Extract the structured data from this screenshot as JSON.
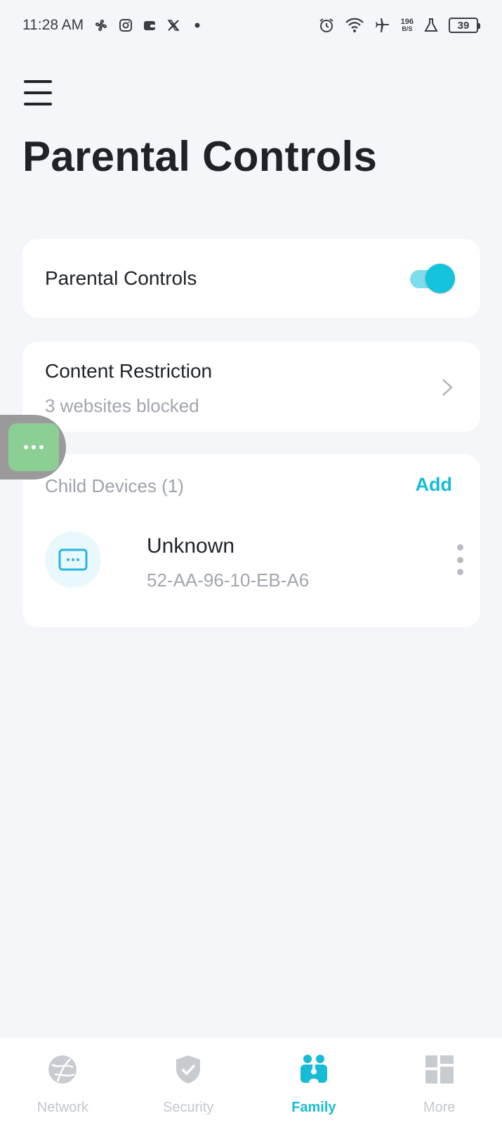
{
  "status_bar": {
    "time": "11:28 AM",
    "left_icons": [
      "fan-icon",
      "instagram-icon",
      "wallet-icon",
      "x-icon",
      "dot-icon"
    ],
    "right_icons": [
      "alarm-icon",
      "wifi-icon",
      "airplane-icon",
      "flask-icon"
    ],
    "net_speed_value": "196",
    "net_speed_unit": "B/S",
    "battery": "39"
  },
  "header": {
    "menu_icon": "hamburger-menu-icon",
    "title": "Parental Controls"
  },
  "parental_controls": {
    "label": "Parental Controls",
    "enabled": true
  },
  "content_restriction": {
    "title": "Content Restriction",
    "subtitle": "3 websites blocked"
  },
  "child_devices": {
    "header": "Child Devices (1)",
    "add_label": "Add",
    "devices": [
      {
        "name": "Unknown",
        "mac": "52-AA-96-10-EB-A6",
        "icon": "device-icon"
      }
    ]
  },
  "bottom_nav": {
    "items": [
      {
        "label": "Network",
        "icon": "globe-icon",
        "active": false
      },
      {
        "label": "Security",
        "icon": "shield-icon",
        "active": false
      },
      {
        "label": "Family",
        "icon": "family-icon",
        "active": true
      },
      {
        "label": "More",
        "icon": "grid-icon",
        "active": false
      }
    ]
  },
  "colors": {
    "accent": "#16bcd6",
    "background": "#f4f6fa",
    "card": "#ffffff"
  }
}
